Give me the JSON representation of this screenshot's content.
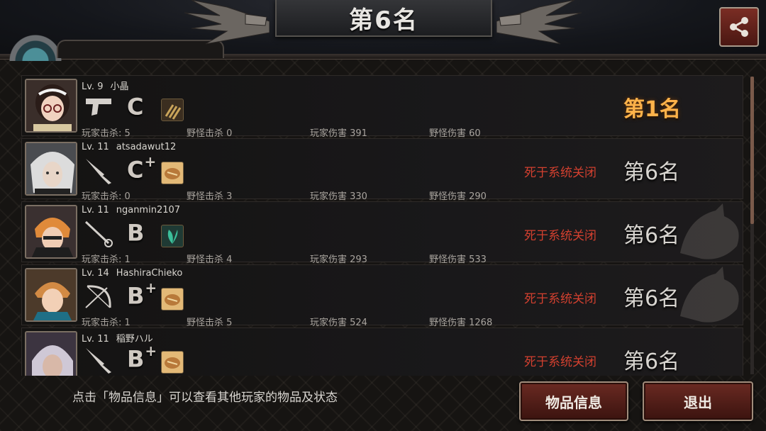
{
  "title": "第6名",
  "header_tab_text": "",
  "players": [
    {
      "level": "Lv. 9",
      "name": "小晶",
      "weapon": "pistol",
      "grade": "C",
      "grade_plus": "",
      "item": "ammo-item",
      "player_kills": "玩家击杀: 5",
      "monster_kills": "野怪击杀 0",
      "player_damage": "玩家伤害 391",
      "monster_damage": "野怪伤害 60",
      "death_reason": "",
      "rank": "第1名"
    },
    {
      "level": "Lv. 11",
      "name": "atsadawut12",
      "weapon": "knife",
      "grade": "C",
      "grade_plus": "+",
      "item": "bread-item",
      "player_kills": "玩家击杀: 0",
      "monster_kills": "野怪击杀 3",
      "player_damage": "玩家伤害 330",
      "monster_damage": "野怪伤害 290",
      "death_reason": "死于系统关闭",
      "rank": "第6名"
    },
    {
      "level": "Lv. 11",
      "name": "nganmin2107",
      "weapon": "rapier",
      "grade": "B",
      "grade_plus": "",
      "item": "herb-item",
      "player_kills": "玩家击杀: 1",
      "monster_kills": "野怪击杀 4",
      "player_damage": "玩家伤害 293",
      "monster_damage": "野怪伤害 533",
      "death_reason": "死于系统关闭",
      "rank": "第6名"
    },
    {
      "level": "Lv. 14",
      "name": "HashiraChieko",
      "weapon": "bow",
      "grade": "B",
      "grade_plus": "+",
      "item": "bread-item",
      "player_kills": "玩家击杀: 1",
      "monster_kills": "野怪击杀 5",
      "player_damage": "玩家伤害 524",
      "monster_damage": "野怪伤害 1268",
      "death_reason": "死于系统关闭",
      "rank": "第6名"
    },
    {
      "level": "Lv. 11",
      "name": "稲野ハル",
      "weapon": "knife",
      "grade": "B",
      "grade_plus": "+",
      "item": "bread-item",
      "player_kills": "",
      "monster_kills": "",
      "player_damage": "",
      "monster_damage": "",
      "death_reason": "死于系统关闭",
      "rank": "第6名"
    }
  ],
  "footer": {
    "hint": "点击「物品信息」可以查看其他玩家的物品及状态",
    "info_button": "物品信息",
    "exit_button": "退出"
  },
  "colors": {
    "accent_red": "#d2402f",
    "rank_gold": "#ffb34a",
    "button_red": "#6a2a22"
  },
  "icons": [
    "share-icon",
    "pistol-icon",
    "knife-icon",
    "rapier-icon",
    "bow-icon",
    "ammo-item-icon",
    "bread-item-icon",
    "herb-item-icon",
    "fox-emblem-icon"
  ]
}
